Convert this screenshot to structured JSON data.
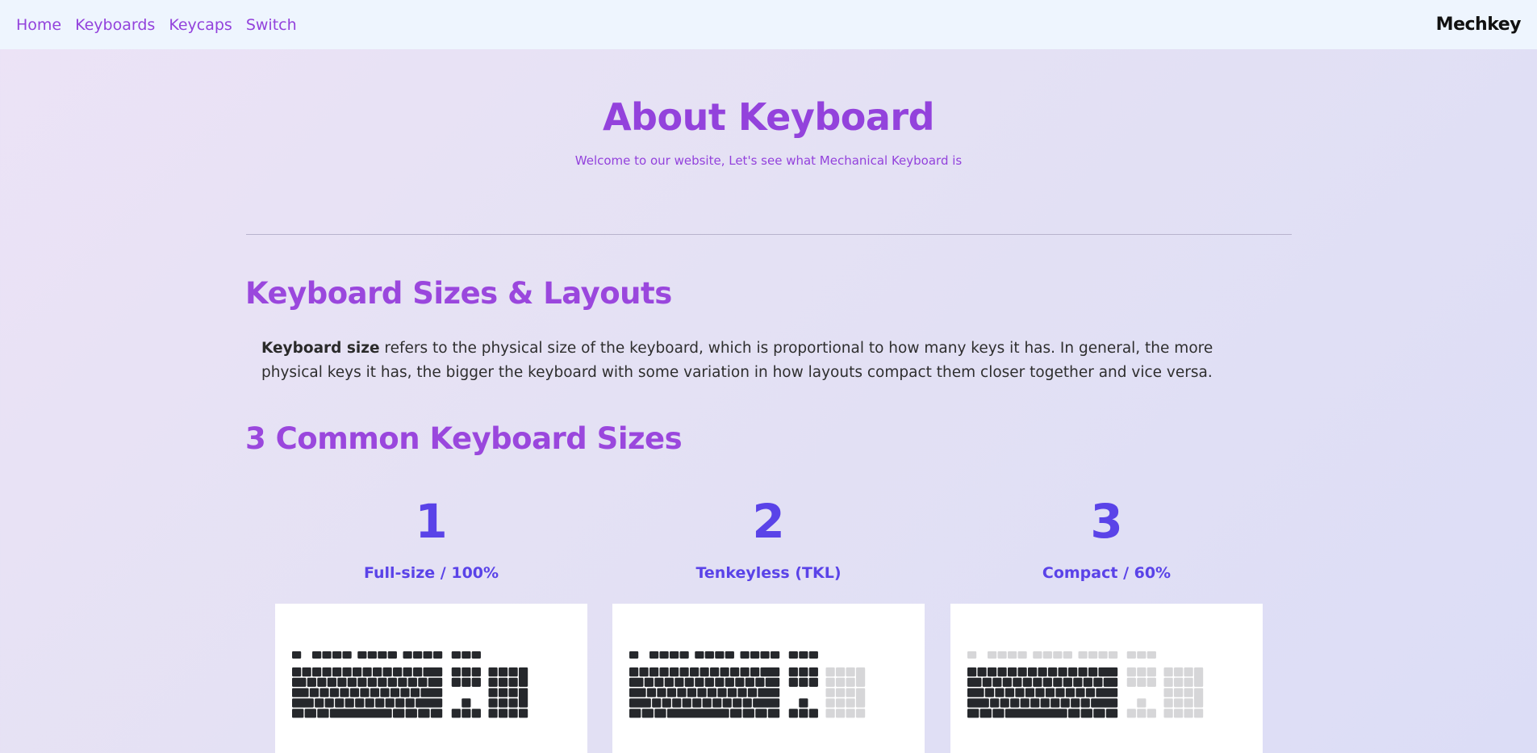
{
  "nav": {
    "links": [
      "Home",
      "Keyboards",
      "Keycaps",
      "Switch"
    ],
    "brand": "Mechkey"
  },
  "hero": {
    "title": "About Keyboard",
    "subtitle": "Welcome to our website, Let's see what Mechanical Keyboard is"
  },
  "sizes_section": {
    "heading": "Keyboard Sizes & Layouts",
    "bold_term": "Keyboard size",
    "body": " refers to the physical size of the keyboard, which is proportional to how many keys it has. In general, the more physical keys it has, the bigger the keyboard with some variation in how layouts compact them closer together and vice versa."
  },
  "common_section": {
    "heading": "3 Common Keyboard Sizes",
    "cards": [
      {
        "number": "1",
        "name": "Full-size / 100%",
        "layout": "full"
      },
      {
        "number": "2",
        "name": "Tenkeyless (TKL)",
        "layout": "tkl"
      },
      {
        "number": "3",
        "name": "Compact / 60%",
        "layout": "compact"
      }
    ]
  },
  "colors": {
    "accent_purple": "#9342dc",
    "number_blue": "#5a43e8",
    "key_dark": "#26282c",
    "key_light": "#d6d6d8"
  }
}
